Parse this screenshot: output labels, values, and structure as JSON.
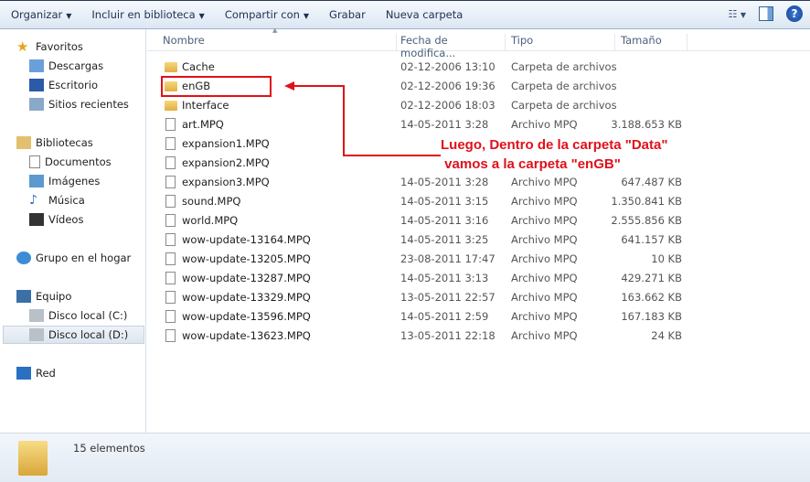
{
  "toolbar": {
    "organize": "Organizar",
    "include": "Incluir en biblioteca",
    "share": "Compartir con",
    "burn": "Grabar",
    "new_folder": "Nueva carpeta",
    "help": "?"
  },
  "sidebar": {
    "favorites": "Favoritos",
    "downloads": "Descargas",
    "desktop": "Escritorio",
    "recent": "Sitios recientes",
    "libraries": "Bibliotecas",
    "documents": "Documentos",
    "images": "Imágenes",
    "music": "Música",
    "videos": "Vídeos",
    "homegroup": "Grupo en el hogar",
    "computer": "Equipo",
    "disk_c": "Disco local (C:)",
    "disk_d": "Disco local (D:)",
    "network": "Red"
  },
  "columns": {
    "name": "Nombre",
    "date": "Fecha de modifica...",
    "type": "Tipo",
    "size": "Tamaño"
  },
  "files": [
    {
      "name": "Cache",
      "date": "02-12-2006 13:10",
      "type": "Carpeta de archivos",
      "size": "",
      "folder": true
    },
    {
      "name": "enGB",
      "date": "02-12-2006 19:36",
      "type": "Carpeta de archivos",
      "size": "",
      "folder": true
    },
    {
      "name": "Interface",
      "date": "02-12-2006 18:03",
      "type": "Carpeta de archivos",
      "size": "",
      "folder": true
    },
    {
      "name": "art.MPQ",
      "date": "14-05-2011 3:28",
      "type": "Archivo MPQ",
      "size": "3.188.653 KB"
    },
    {
      "name": "expansion1.MPQ",
      "date": "",
      "type": "",
      "size": ""
    },
    {
      "name": "expansion2.MPQ",
      "date": "",
      "type": "",
      "size": ""
    },
    {
      "name": "expansion3.MPQ",
      "date": "14-05-2011 3:28",
      "type": "Archivo MPQ",
      "size": "647.487 KB"
    },
    {
      "name": "sound.MPQ",
      "date": "14-05-2011 3:15",
      "type": "Archivo MPQ",
      "size": "1.350.841 KB"
    },
    {
      "name": "world.MPQ",
      "date": "14-05-2011 3:16",
      "type": "Archivo MPQ",
      "size": "2.555.856 KB"
    },
    {
      "name": "wow-update-13164.MPQ",
      "date": "14-05-2011 3:25",
      "type": "Archivo MPQ",
      "size": "641.157 KB"
    },
    {
      "name": "wow-update-13205.MPQ",
      "date": "23-08-2011 17:47",
      "type": "Archivo MPQ",
      "size": "10 KB"
    },
    {
      "name": "wow-update-13287.MPQ",
      "date": "14-05-2011 3:13",
      "type": "Archivo MPQ",
      "size": "429.271 KB"
    },
    {
      "name": "wow-update-13329.MPQ",
      "date": "13-05-2011 22:57",
      "type": "Archivo MPQ",
      "size": "163.662 KB"
    },
    {
      "name": "wow-update-13596.MPQ",
      "date": "14-05-2011 2:59",
      "type": "Archivo MPQ",
      "size": "167.183 KB"
    },
    {
      "name": "wow-update-13623.MPQ",
      "date": "13-05-2011 22:18",
      "type": "Archivo MPQ",
      "size": "24 KB"
    }
  ],
  "status": {
    "count": "15 elementos"
  },
  "annotation": {
    "line1": "Luego, Dentro de la carpeta \"Data\"",
    "line2": " vamos a la carpeta \"enGB\"",
    "color": "#e0101a"
  }
}
